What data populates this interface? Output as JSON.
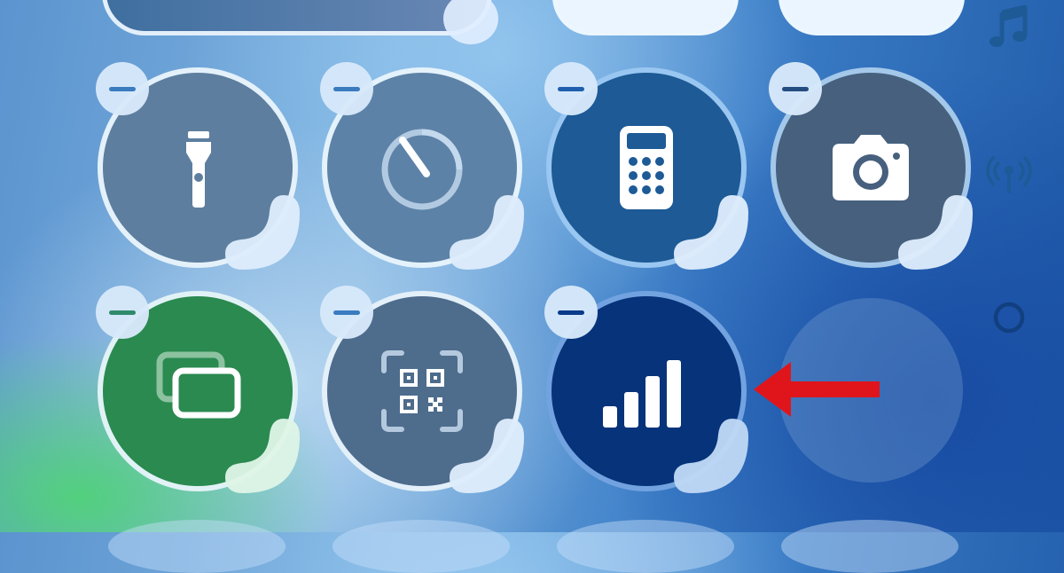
{
  "screen": {
    "title": ""
  },
  "controls": [
    {
      "id": "flashlight",
      "icon": "flashlight-icon",
      "badge": "minus"
    },
    {
      "id": "timer",
      "icon": "timer-icon",
      "badge": "minus"
    },
    {
      "id": "calculator",
      "icon": "calculator-icon",
      "badge": "minus"
    },
    {
      "id": "camera",
      "icon": "camera-icon",
      "badge": "minus"
    },
    {
      "id": "screen-mirroring",
      "icon": "screen-mirroring-icon",
      "badge": "minus"
    },
    {
      "id": "code-scanner",
      "icon": "qr-code-scanner-icon",
      "badge": "minus"
    },
    {
      "id": "cellular-data",
      "icon": "cellular-signal-icon",
      "badge": "minus",
      "highlighted": true
    },
    {
      "id": "empty-slot",
      "icon": "",
      "badge": ""
    }
  ],
  "side_icons": [
    "music-note-icon",
    "antenna-signal-icon",
    "ring-icon"
  ],
  "annotation": {
    "type": "arrow",
    "points_to": "cellular-data",
    "color": "#e0151b"
  },
  "colors": {
    "tile_border": "#ebf8ff",
    "badge_bg": "#d7e8fa",
    "badge_bar": "#3b7bc0",
    "cellular_tile": "#07337a",
    "mirroring_tile": "#2a8a50"
  }
}
